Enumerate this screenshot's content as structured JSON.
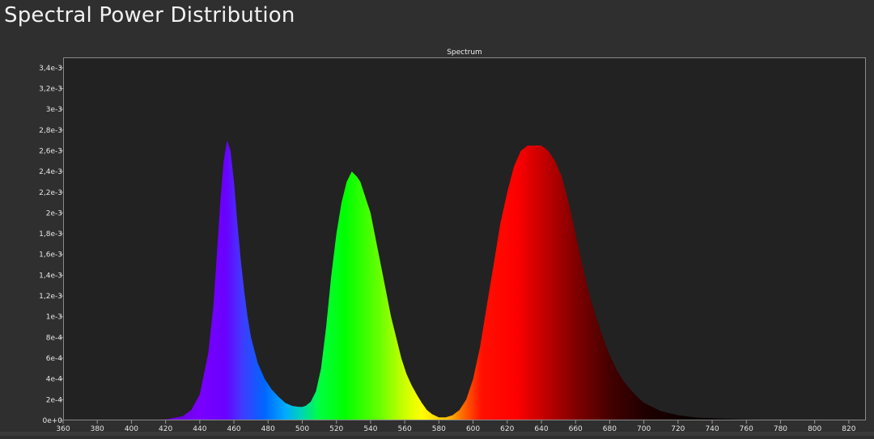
{
  "header": {
    "title": "Spectral Power Distribution"
  },
  "chart_data": {
    "type": "area",
    "title": "Spectrum",
    "xlabel": "",
    "ylabel": "",
    "xlim": [
      360,
      830
    ],
    "ylim": [
      0,
      0.0035
    ],
    "grid": false,
    "x_ticks": [
      360,
      380,
      400,
      420,
      440,
      460,
      480,
      500,
      520,
      540,
      560,
      580,
      600,
      620,
      640,
      660,
      680,
      700,
      720,
      740,
      760,
      780,
      800,
      820
    ],
    "x_tick_labels": [
      "360",
      "380",
      "400",
      "420",
      "440",
      "460",
      "480",
      "500",
      "520",
      "540",
      "560",
      "580",
      "600",
      "620",
      "640",
      "660",
      "680",
      "700",
      "720",
      "740",
      "760",
      "780",
      "800",
      "820"
    ],
    "y_ticks": [
      0,
      0.0002,
      0.0004,
      0.0006,
      0.0008,
      0.001,
      0.0012,
      0.0014,
      0.0016,
      0.0018,
      0.002,
      0.0022,
      0.0024,
      0.0026,
      0.0028,
      0.003,
      0.0032,
      0.0034
    ],
    "y_tick_labels": [
      "0e+0",
      "2e-4",
      "4e-4",
      "6e-4",
      "8e-4",
      "1e-3",
      "1,2e-3",
      "1,4e-3",
      "1,6e-3",
      "1,8e-3",
      "2e-3",
      "2,2e-3",
      "2,4e-3",
      "2,6e-3",
      "2,8e-3",
      "3e-3",
      "3,2e-3",
      "3,4e-3"
    ],
    "series": [
      {
        "x": [
          360,
          400,
          420,
          430,
          435,
          440,
          445,
          448,
          450,
          452,
          454,
          456,
          458,
          460,
          462,
          464,
          466,
          468,
          470,
          474,
          478,
          482,
          486,
          490,
          494,
          498,
          500,
          502,
          505,
          508,
          511,
          514,
          517,
          520,
          523,
          526,
          529,
          532,
          534,
          536,
          538,
          540,
          543,
          546,
          549,
          552,
          555,
          558,
          561,
          564,
          567,
          570,
          573,
          576,
          580,
          584,
          588,
          592,
          596,
          600,
          604,
          608,
          612,
          616,
          620,
          624,
          628,
          632,
          636,
          640,
          644,
          648,
          652,
          656,
          660,
          664,
          668,
          672,
          676,
          680,
          684,
          688,
          692,
          696,
          700,
          710,
          720,
          730,
          740,
          760,
          780,
          800,
          830
        ],
        "y": [
          0,
          2e-06,
          1e-05,
          4e-05,
          0.0001,
          0.00025,
          0.00065,
          0.0011,
          0.0016,
          0.0021,
          0.0025,
          0.0027,
          0.0026,
          0.0023,
          0.0019,
          0.00155,
          0.00125,
          0.001,
          0.0008,
          0.00055,
          0.0004,
          0.0003,
          0.00023,
          0.00017,
          0.00014,
          0.00013,
          0.00013,
          0.00014,
          0.00018,
          0.00028,
          0.0005,
          0.0009,
          0.0014,
          0.0018,
          0.0021,
          0.0023,
          0.0024,
          0.00235,
          0.0023,
          0.0022,
          0.0021,
          0.002,
          0.00175,
          0.0015,
          0.00125,
          0.001,
          0.0008,
          0.0006,
          0.00045,
          0.00034,
          0.00025,
          0.00017,
          0.0001,
          6e-05,
          3e-05,
          3e-05,
          5e-05,
          0.0001,
          0.0002,
          0.0004,
          0.0007,
          0.0011,
          0.0015,
          0.0019,
          0.0022,
          0.00245,
          0.0026,
          0.00265,
          0.00265,
          0.00265,
          0.0026,
          0.0025,
          0.00235,
          0.0021,
          0.0018,
          0.0015,
          0.00122,
          0.001,
          0.0008,
          0.00063,
          0.00049,
          0.00038,
          0.0003,
          0.00023,
          0.00017,
          9e-05,
          5e-05,
          3e-05,
          2e-05,
          1e-05,
          4e-06,
          1e-06,
          0
        ]
      }
    ]
  }
}
